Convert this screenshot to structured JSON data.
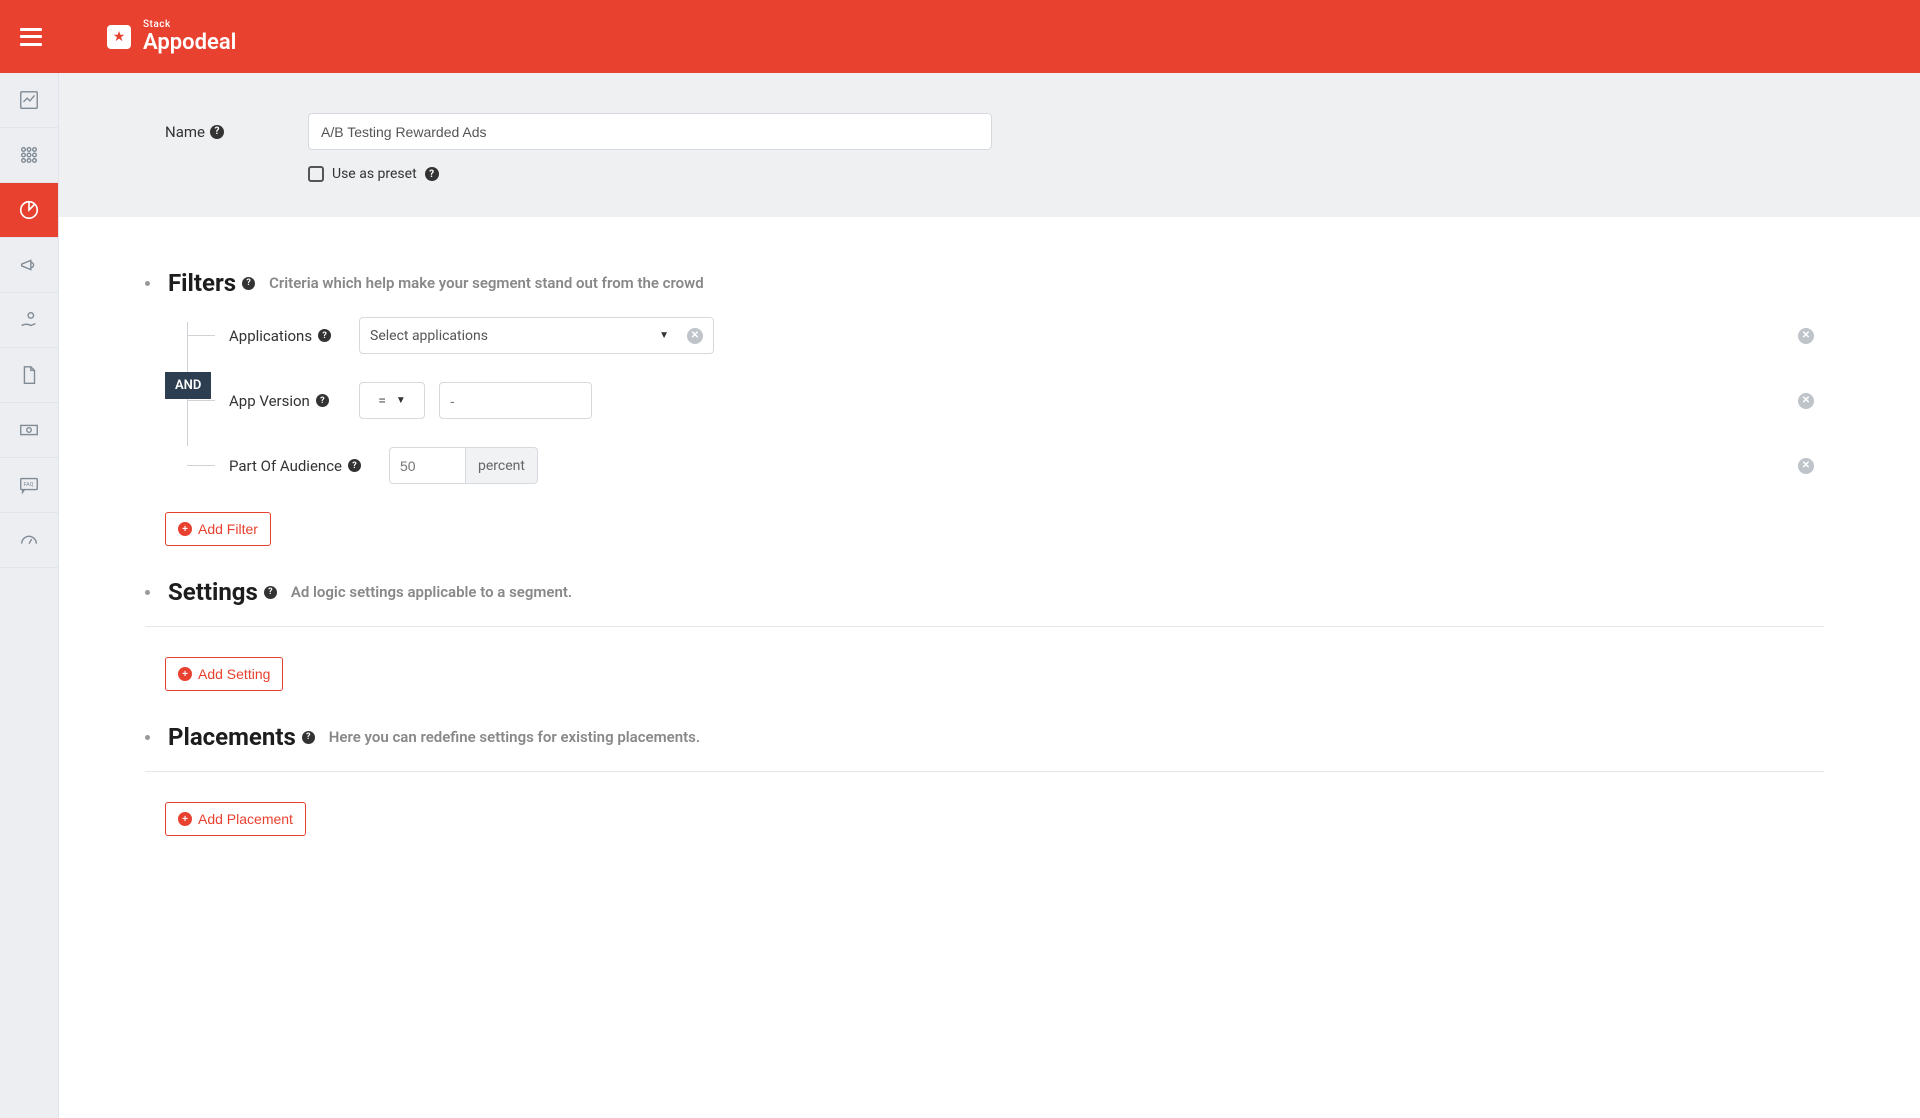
{
  "header": {
    "small": "Stack",
    "brand": "Appodeal"
  },
  "name_section": {
    "label": "Name",
    "value": "A/B Testing Rewarded Ads",
    "preset_label": "Use as preset"
  },
  "filters": {
    "title": "Filters",
    "desc": "Criteria which help make your segment stand out from the crowd",
    "and_label": "AND",
    "rows": {
      "applications": {
        "label": "Applications",
        "placeholder": "Select applications"
      },
      "app_version": {
        "label": "App Version",
        "operator": "=",
        "value_placeholder": "-"
      },
      "audience": {
        "label": "Part Of Audience",
        "value_placeholder": "50",
        "unit": "percent"
      }
    },
    "add_button": "Add Filter"
  },
  "settings": {
    "title": "Settings",
    "desc": "Ad logic settings applicable to a segment.",
    "add_button": "Add Setting"
  },
  "placements": {
    "title": "Placements",
    "desc": "Here you can redefine settings for existing placements.",
    "add_button": "Add Placement"
  }
}
